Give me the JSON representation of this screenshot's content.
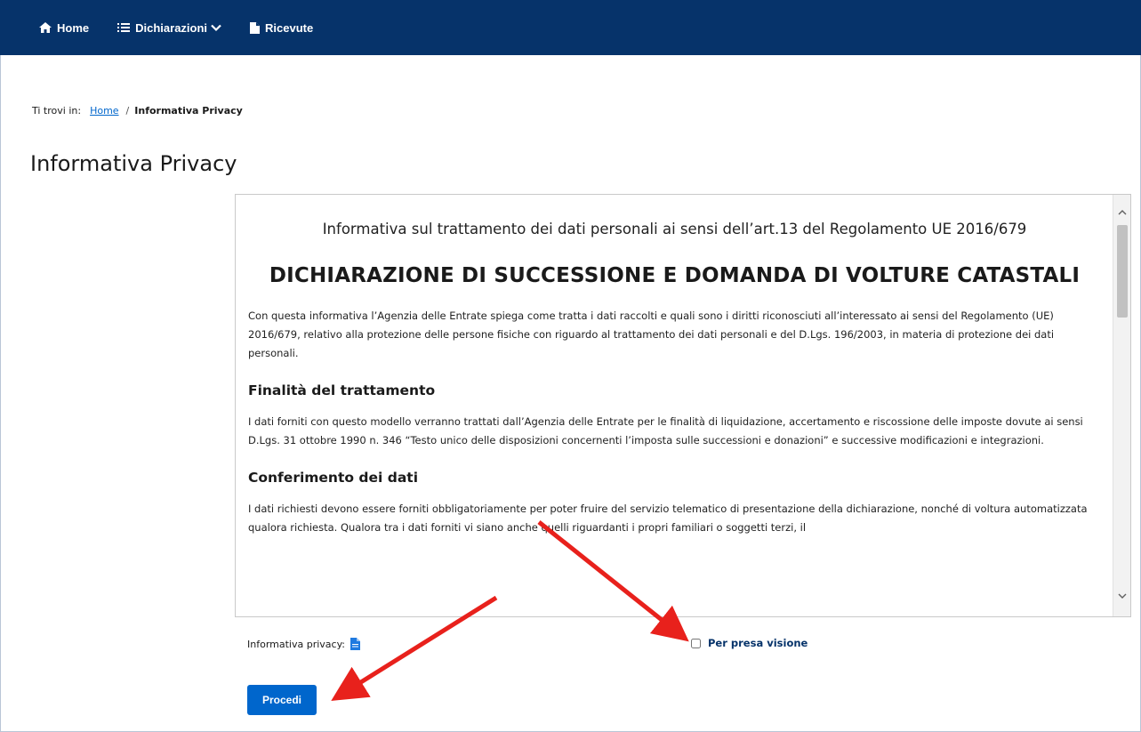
{
  "nav": {
    "items": [
      {
        "label": "Home",
        "icon": "home-icon"
      },
      {
        "label": "Dichiarazioni",
        "icon": "list-icon",
        "has_dropdown": true
      },
      {
        "label": "Ricevute",
        "icon": "document-icon"
      }
    ],
    "background_color": "#06336a"
  },
  "breadcrumb": {
    "prefix": "Ti trovi in:",
    "home": "Home",
    "separator": "/",
    "current": "Informativa Privacy"
  },
  "page_title": "Informativa Privacy",
  "document": {
    "subtitle": "Informativa sul trattamento dei dati personali ai sensi dell’art.13 del Regolamento UE 2016/679",
    "heading": "DICHIARAZIONE DI SUCCESSIONE E DOMANDA DI VOLTURE CATASTALI",
    "intro": "Con questa informativa l’Agenzia delle Entrate spiega come tratta i dati raccolti e quali sono i diritti riconosciuti all’interessato ai sensi del Regolamento (UE) 2016/679, relativo alla protezione delle persone fisiche con riguardo al trattamento dei dati personali e del D.Lgs. 196/2003, in materia di protezione dei dati personali.",
    "sections": [
      {
        "title": "Finalità del trattamento",
        "text": "I dati forniti con questo modello verranno trattati dall’Agenzia delle Entrate per le finalità di liquidazione, accertamento e riscossione delle imposte dovute ai sensi D.Lgs. 31 ottobre 1990 n. 346 “Testo unico delle disposizioni concernenti l’imposta sulle successioni e donazioni” e successive modificazioni e integrazioni."
      },
      {
        "title": "Conferimento dei dati",
        "text": "I dati richiesti devono essere forniti obbligatoriamente per poter fruire del servizio telematico di presentazione della dichiarazione, nonché di voltura automatizzata qualora richiesta. Qualora tra i dati forniti vi siano anche quelli riguardanti i propri familiari o soggetti terzi, il"
      }
    ]
  },
  "footer": {
    "privacy_label": "Informativa privacy:",
    "consent_label": "Per presa visione",
    "consent_checked": false
  },
  "actions": {
    "proceed_label": "Procedi"
  },
  "annotations": {
    "arrow_color": "#e8211c"
  },
  "colors": {
    "primary": "#0066cc",
    "navy": "#06336a"
  }
}
